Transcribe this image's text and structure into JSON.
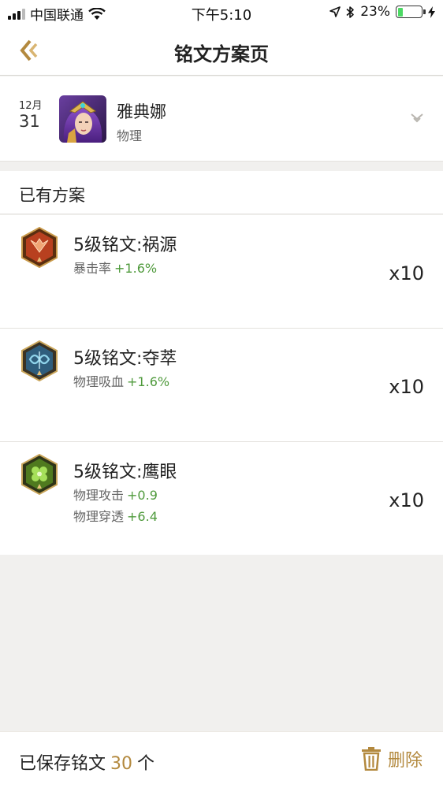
{
  "status_bar": {
    "carrier": "中国联通",
    "time": "下午5:10",
    "battery_percent": "23%",
    "battery_level": 0.23,
    "icons": [
      "signal-icon",
      "wifi-icon",
      "location-icon",
      "bluetooth-icon",
      "battery-icon",
      "charging-icon"
    ]
  },
  "nav": {
    "title": "铭文方案页",
    "back_icon": "back-arrow-icon"
  },
  "hero": {
    "month": "12月",
    "day": "31",
    "name": "雅典娜",
    "type": "物理",
    "chevron_icon": "chevron-down-icon"
  },
  "section": {
    "title": "已有方案"
  },
  "inscriptions": [
    {
      "name": "5级铭文:祸源",
      "icon": "red-inscription-icon",
      "stats": [
        {
          "label": "暴击率",
          "value": "+1.6%"
        }
      ],
      "count": "x10"
    },
    {
      "name": "5级铭文:夺萃",
      "icon": "blue-inscription-icon",
      "stats": [
        {
          "label": "物理吸血",
          "value": "+1.6%"
        }
      ],
      "count": "x10"
    },
    {
      "name": "5级铭文:鹰眼",
      "icon": "green-inscription-icon",
      "stats": [
        {
          "label": "物理攻击",
          "value": "+0.9"
        },
        {
          "label": "物理穿透",
          "value": "+6.4"
        }
      ],
      "count": "x10"
    }
  ],
  "footer": {
    "saved_prefix": "已保存铭文",
    "saved_count": "30",
    "saved_suffix": "个",
    "delete_label": "删除",
    "delete_icon": "trash-icon"
  },
  "colors": {
    "accent": "#b3893e",
    "stat_value": "#4f9a3c",
    "background": "#f1f0ee"
  }
}
